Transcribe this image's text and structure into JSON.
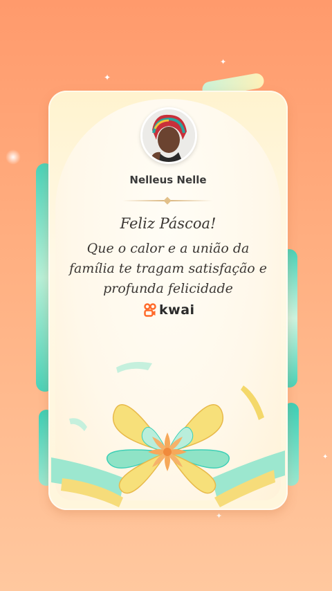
{
  "card": {
    "author_name": "Nelleus Nelle",
    "greeting": "Feliz Páscoa!",
    "message": "Que o calor e a união da família te tragam satisfação e profunda felicidade",
    "brand_name": "kwai"
  },
  "icons": {
    "brand_logo": "kwai-logo-icon",
    "sparkle": "sparkle-icon"
  },
  "colors": {
    "background_top": "#ff9a6c",
    "background_bottom": "#ffc89f",
    "card": "#fff6dc",
    "ribbon_teal": "#3ccfb6",
    "ribbon_yellow": "#f7d96a",
    "flower_orange": "#f6a85a",
    "brand_orange": "#ff6a2a"
  }
}
